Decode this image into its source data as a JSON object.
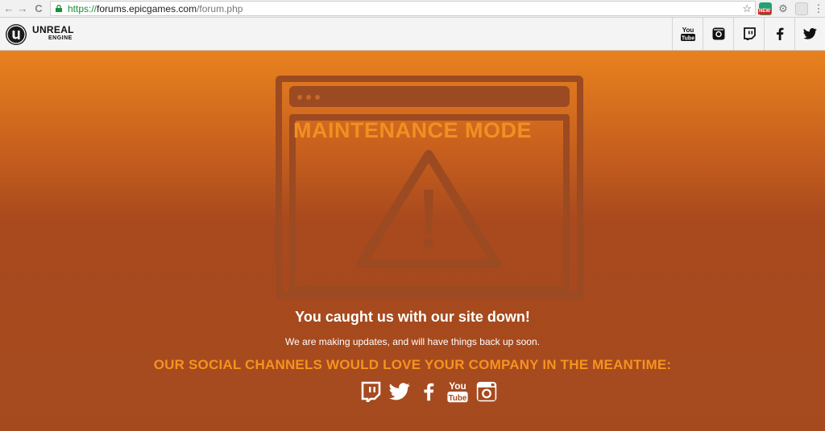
{
  "browser": {
    "url_scheme": "https://",
    "url_host": "forums.epicgames.com",
    "url_path": "/forum.php",
    "back_glyph": "←",
    "forward_glyph": "→",
    "reload_glyph": "C",
    "star_glyph": "☆",
    "extension_badge": "NEW",
    "menu_glyph": "⋮"
  },
  "header": {
    "logo_line1": "UNREAL",
    "logo_line2": "ENGINE",
    "social_icons": [
      "youtube-icon",
      "instagram-icon",
      "twitch-icon",
      "facebook-icon",
      "twitter-icon"
    ]
  },
  "main": {
    "window_title": "MAINTENANCE MODE",
    "headline": "You caught us with our site down!",
    "subtext": "We are making updates, and will have things back up soon.",
    "social_message": "OUR SOCIAL CHANNELS WOULD LOVE YOUR COMPANY IN THE MEANTIME:",
    "social_icons": [
      "twitch-icon",
      "twitter-icon",
      "facebook-icon",
      "youtube-icon",
      "instagram-icon"
    ]
  },
  "colors": {
    "accent_orange": "#f28f22",
    "window_outline": "#9b4a22",
    "background_top": "#e8821e",
    "background_bottom": "#a54a1f"
  }
}
